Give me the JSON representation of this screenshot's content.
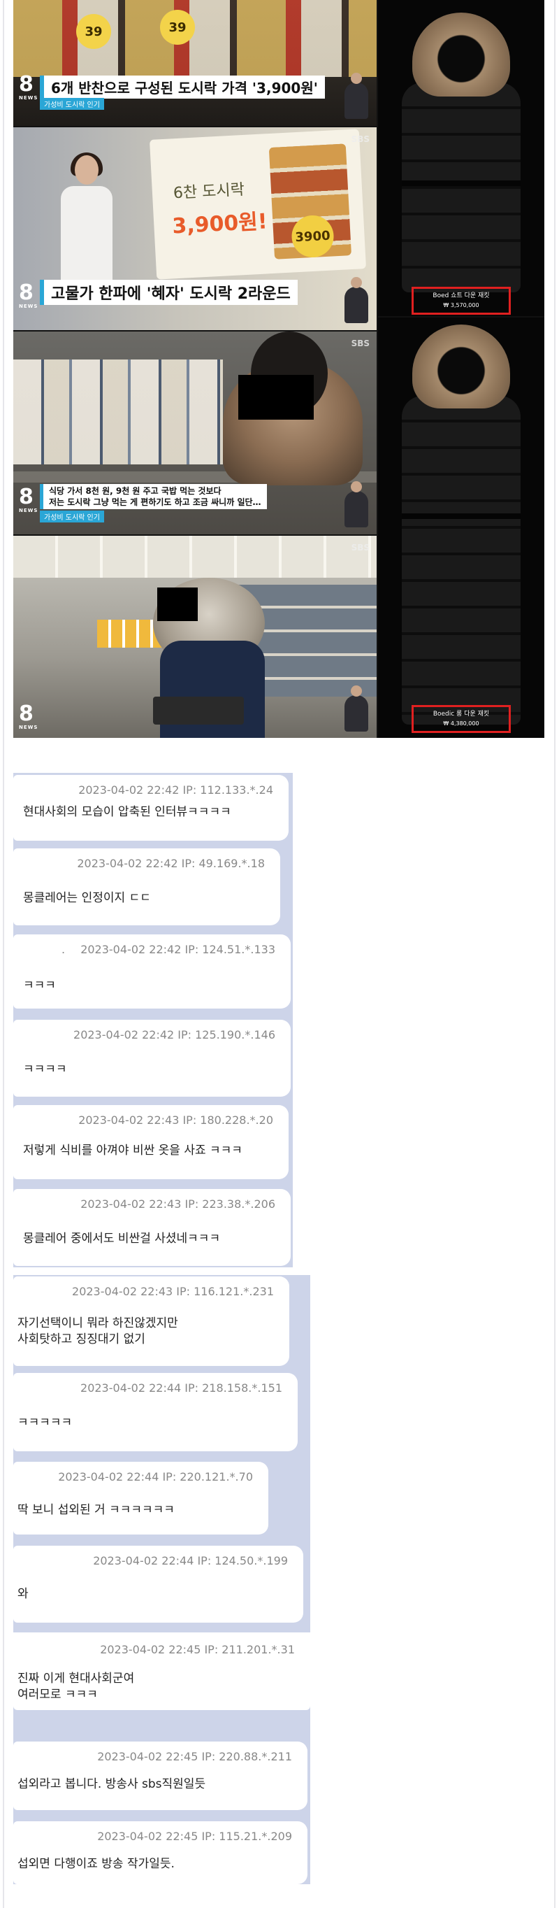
{
  "collage": {
    "news1": {
      "channel": "8",
      "channel_sub": "NEWS",
      "price_tag": "39",
      "caption": "6개 반찬으로 구성된 도시락 가격 '3,900원'",
      "sub_caption": "가성비 도시락 인기"
    },
    "news2": {
      "channel": "8",
      "channel_sub": "NEWS",
      "sbs": "SBS",
      "board_title": "6찬 도시락",
      "board_price": "3,900원!",
      "badge": "3900",
      "caption": "고물가 한파에 '혜자' 도시락 2라운드"
    },
    "news3": {
      "channel": "8",
      "channel_sub": "NEWS",
      "sbs": "SBS",
      "caption_line1": "식당 가서 8천 원, 9천 원 주고 국밥 먹는 것보다",
      "caption_line2": "저는 도시락 그냥 먹는 게 편하기도 하고 조금 싸니까 일단…",
      "sub_caption": "가성비 도시락 인기"
    },
    "news4": {
      "channel": "8",
      "channel_sub": "NEWS",
      "sbs": "SBS"
    },
    "coat1": {
      "name": "Boed 쇼트 다운 재킷",
      "price": "₩ 3,570,000"
    },
    "coat2": {
      "name": "Boedic 롱 다운 재킷",
      "price": "₩ 4,380,000"
    }
  },
  "comments": [
    {
      "meta": "2023-04-02 22:42 IP: 112.133.*.24",
      "text": "현대사회의 모습이 압축된 인터뷰ㅋㅋㅋㅋ"
    },
    {
      "meta": "2023-04-02 22:42 IP: 49.169.*.18",
      "text": "몽클레어는 인정이지 ㄷㄷ"
    },
    {
      "lead": ".",
      "meta": "2023-04-02 22:42 IP: 124.51.*.133",
      "text": "ㅋㅋㅋ"
    },
    {
      "meta": "2023-04-02 22:42 IP: 125.190.*.146",
      "text": "ㅋㅋㅋㅋ"
    },
    {
      "meta": "2023-04-02 22:43 IP: 180.228.*.20",
      "text": "저렇게 식비를 아껴야 비싼 옷을 사죠 ㅋㅋㅋ"
    },
    {
      "meta": "2023-04-02 22:43 IP: 223.38.*.206",
      "text": "몽클레어 중에서도 비싼걸 사셨네ㅋㅋㅋ"
    },
    {
      "meta": "2023-04-02 22:43 IP: 116.121.*.231",
      "text": "자기선택이니 뭐라 하진않겠지만\n사회탓하고 징징대기 없기"
    },
    {
      "meta": "2023-04-02 22:44 IP: 218.158.*.151",
      "text": "ㅋㅋㅋㅋㅋ"
    },
    {
      "meta": "2023-04-02 22:44 IP: 220.121.*.70",
      "text": "딱 보니 섭외된 거 ㅋㅋㅋㅋㅋㅋ"
    },
    {
      "meta": "2023-04-02 22:44 IP: 124.50.*.199",
      "text": "와"
    },
    {
      "meta": "2023-04-02 22:45 IP: 211.201.*.31",
      "text": "진짜 이게 현대사회군여\n여러모로 ㅋㅋㅋ"
    },
    {
      "meta": "2023-04-02 22:45 IP: 220.88.*.211",
      "text": "섭외라고 봅니다. 방송사 sbs직원일듯"
    },
    {
      "meta": "2023-04-02 22:45 IP: 115.21.*.209",
      "text": "섭외면 다행이죠 방송 작가일듯."
    }
  ]
}
